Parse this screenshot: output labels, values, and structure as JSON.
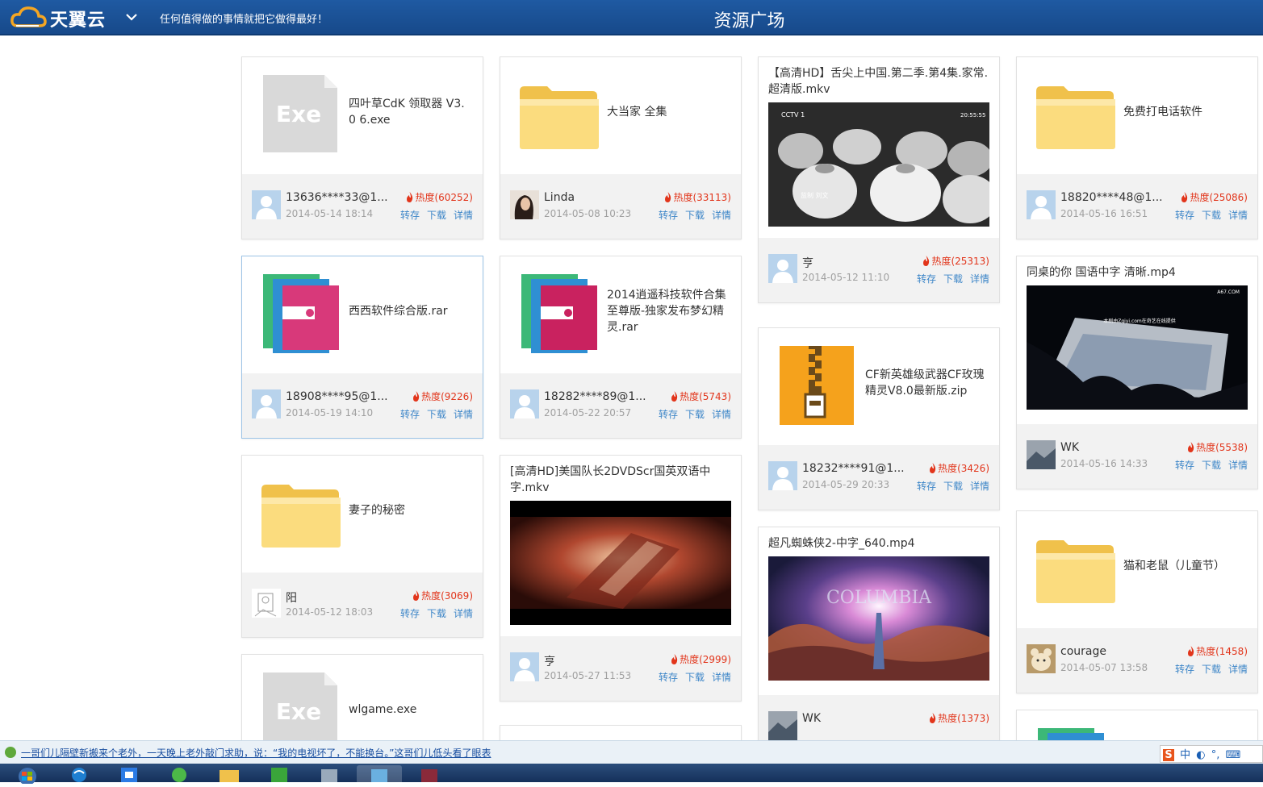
{
  "header": {
    "logo_text": "天翼云",
    "slogan": "任何值得做的事情就把它做得最好！",
    "title": "资源广场"
  },
  "labels": {
    "heat_prefix": "热度",
    "save": "转存",
    "download": "下载",
    "details": "详情"
  },
  "colors": {
    "header": "#1f5aa2",
    "heat": "#e2351b",
    "link": "#3d86c8",
    "folder": "#f8d46b"
  },
  "cards": [
    {
      "name": "四叶草CdK 领取器 V3.0 6.exe",
      "icon": "exe-file-icon",
      "user": "13636****33@1...",
      "date": "2014-05-14 18:14",
      "heat": "(60252)"
    },
    {
      "name": "大当家 全集",
      "icon": "folder-icon",
      "user": "Linda",
      "date": "2014-05-08 10:23",
      "heat": "(33113)"
    },
    {
      "name": "【高清HD】舌尖上中国.第二季.第4集.家常.超清版.mkv",
      "icon": "video-thumbnail",
      "user": "亨",
      "date": "2014-05-12 11:10",
      "heat": "(25313)"
    },
    {
      "name": "免费打电话软件",
      "icon": "folder-icon",
      "user": "18820****48@1...",
      "date": "2014-05-16 16:51",
      "heat": "(25086)"
    },
    {
      "name": "西西软件综合版.rar",
      "icon": "rar-file-icon",
      "user": "18908****95@1...",
      "date": "2014-05-19 14:10",
      "heat": "(9226)"
    },
    {
      "name": "2014逍遥科技软件合集至尊版-独家发布梦幻精灵.rar",
      "icon": "rar-file-icon",
      "user": "18282****89@1...",
      "date": "2014-05-22 20:57",
      "heat": "(5743)"
    },
    {
      "name": "CF新英雄级武器CF玫瑰精灵V8.0最新版.zip",
      "icon": "zip-file-icon",
      "user": "18232****91@1...",
      "date": "2014-05-29 20:33",
      "heat": "(3426)"
    },
    {
      "name": "同桌的你 国语中字 清晰.mp4",
      "icon": "video-thumbnail",
      "user": "WK",
      "date": "2014-05-16 14:33",
      "heat": "(5538)"
    },
    {
      "name": "妻子的秘密",
      "icon": "folder-icon",
      "user": "阳",
      "date": "2014-05-12 18:03",
      "heat": "(3069)"
    },
    {
      "name": "[高清HD]美国队长2DVDScr国英双语中字.mkv",
      "icon": "video-thumbnail",
      "user": "亨",
      "date": "2014-05-27 11:53",
      "heat": "(2999)"
    },
    {
      "name": "超凡蜘蛛侠2-中字_640.mp4",
      "icon": "video-thumbnail",
      "user": "WK",
      "date": "",
      "heat": "(1373)"
    },
    {
      "name": "猫和老鼠（儿童节）",
      "icon": "folder-icon",
      "user": "courage",
      "date": "2014-05-07 13:58",
      "heat": "(1458)"
    },
    {
      "name": "wlgame.exe",
      "icon": "exe-file-icon",
      "user": "",
      "date": "",
      "heat": ""
    }
  ],
  "thumb_text": {
    "exe": "Exe",
    "cctv": "CCTV 1",
    "timecode": "20:55:55",
    "credit": "监制 刘文",
    "a67": "A67.COM",
    "zqiyi": "本剧由Zqiyi.com在奇艺在线提供",
    "columbia": "COLUMBIA"
  },
  "newsbar": {
    "text": "一哥们儿隔壁新搬来个老外，一天晚上老外敲门求助，说：“我的电视坏了，不能换台。”这哥们儿低头看了眼表"
  },
  "ime": {
    "indicator": "S",
    "lang": "中"
  }
}
